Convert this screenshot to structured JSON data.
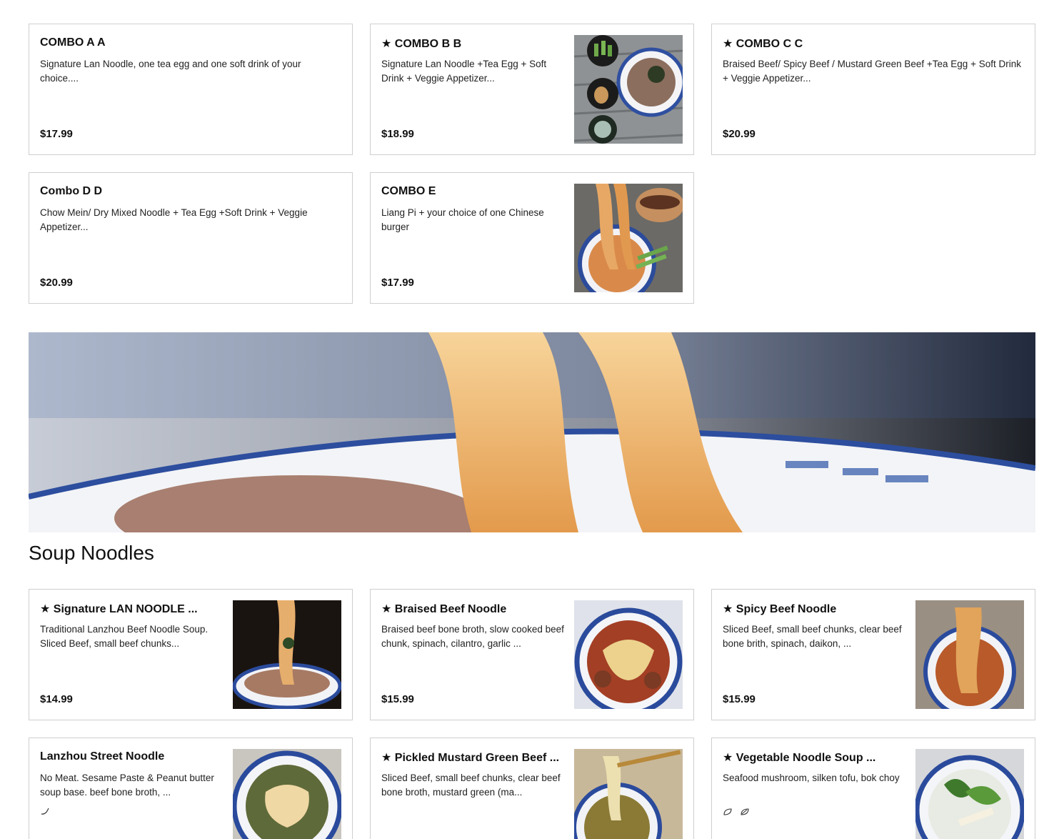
{
  "combos": [
    {
      "title": "COMBO A  A",
      "desc": "Signature Lan Noodle, one tea egg and one soft drink of your choice....",
      "price": "$17.99",
      "image": null
    },
    {
      "title": "★ COMBO B      B",
      "desc": "Signature Lan Noodle +Tea Egg + Soft Drink + Veggie Appetizer...",
      "price": "$18.99",
      "image": "combo-b-photo"
    },
    {
      "title": "★ COMBO C  C",
      "desc": "Braised Beef/ Spicy Beef / Mustard Green Beef +Tea Egg + Soft Drink + Veggie Appetizer...",
      "price": "$20.99",
      "image": null
    },
    {
      "title": "Combo D  D",
      "desc": "Chow Mein/ Dry Mixed Noodle + Tea Egg +Soft Drink + Veggie Appetizer...",
      "price": "$20.99",
      "image": null
    },
    {
      "title": "COMBO E",
      "desc": "Liang Pi + your choice of one Chinese burger",
      "price": "$17.99",
      "image": "combo-e-photo"
    }
  ],
  "banner": {
    "image": "noodle-banner-photo"
  },
  "section": {
    "title": "Soup Noodles"
  },
  "soups": [
    {
      "title": "★ Signature LAN NOODLE      ...",
      "desc": "Traditional Lanzhou Beef Noodle Soup. Sliced Beef, small beef chunks...",
      "price": "$14.99",
      "image": "signature-noodle-photo"
    },
    {
      "title": "★ Braised Beef Noodle",
      "desc": "Braised beef bone broth, slow cooked beef chunk, spinach, cilantro, garlic ...",
      "price": "$15.99",
      "image": "braised-beef-photo"
    },
    {
      "title": "★ Spicy Beef Noodle",
      "desc": "Sliced Beef, small beef chunks, clear beef bone brith, spinach, daikon, ...",
      "price": "$15.99",
      "image": "spicy-beef-photo"
    },
    {
      "title": "Lanzhou Street Noodle",
      "desc": "No Meat. Sesame Paste & Peanut butter soup base. beef bone broth, ...",
      "price": "",
      "image": "street-noodle-photo",
      "icons": [
        "pepper-icon"
      ]
    },
    {
      "title": "★ Pickled Mustard Green Beef ...",
      "desc": "Sliced Beef, small beef chunks, clear beef bone broth, mustard green (ma...",
      "price": "",
      "image": "mustard-green-photo"
    },
    {
      "title": "★ Vegetable Noodle Soup        ...",
      "desc": "Seafood mushroom, silken tofu, bok choy",
      "price": "",
      "image": "vegetable-noodle-photo",
      "icons": [
        "vegetarian-icon",
        "vegan-icon"
      ]
    }
  ]
}
